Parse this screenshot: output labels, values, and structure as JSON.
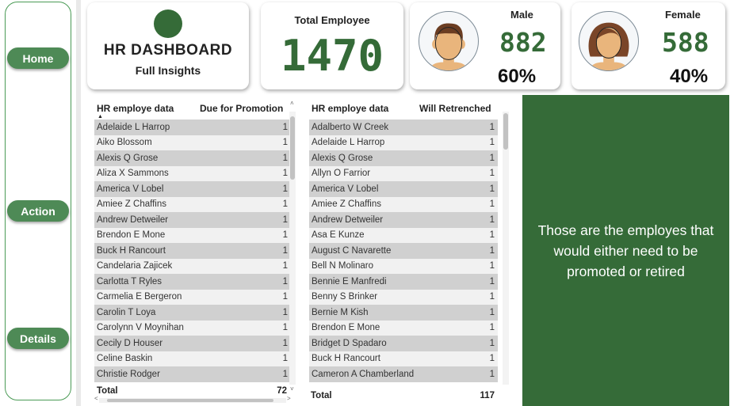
{
  "nav": {
    "home": "Home",
    "action": "Action",
    "details": "Details"
  },
  "header": {
    "title": "HR DASHBOARD",
    "subtitle": "Full Insights",
    "total_label": "Total Employee",
    "total_value": "1470",
    "male_label": "Male",
    "male_value": "882",
    "male_pct": "60%",
    "female_label": "Female",
    "female_value": "588",
    "female_pct": "40%"
  },
  "promotion_table": {
    "col_name": "HR employe data",
    "col_value": "Due for Promotion",
    "rows": [
      {
        "name": "Adelaide L Harrop",
        "value": "1"
      },
      {
        "name": "Aiko Blossom",
        "value": "1"
      },
      {
        "name": "Alexis Q Grose",
        "value": "1"
      },
      {
        "name": "Aliza X Sammons",
        "value": "1"
      },
      {
        "name": "America V Lobel",
        "value": "1"
      },
      {
        "name": "Amiee Z Chaffins",
        "value": "1"
      },
      {
        "name": "Andrew Detweiler",
        "value": "1"
      },
      {
        "name": "Brendon E Mone",
        "value": "1"
      },
      {
        "name": "Buck H Rancourt",
        "value": "1"
      },
      {
        "name": "Candelaria Zajicek",
        "value": "1"
      },
      {
        "name": "Carlotta T Ryles",
        "value": "1"
      },
      {
        "name": "Carmelia E Bergeron",
        "value": "1"
      },
      {
        "name": "Carolin T Loya",
        "value": "1"
      },
      {
        "name": "Carolynn V Moynihan",
        "value": "1"
      },
      {
        "name": "Cecily D Houser",
        "value": "1"
      },
      {
        "name": "Celine Baskin",
        "value": "1"
      },
      {
        "name": "Christie Rodger",
        "value": "1"
      }
    ],
    "total_label": "Total",
    "total_value": "72"
  },
  "retrench_table": {
    "col_name": "HR employe data",
    "col_value": "Will Retrenched",
    "rows": [
      {
        "name": "Adalberto W Creek",
        "value": "1"
      },
      {
        "name": "Adelaide L Harrop",
        "value": "1"
      },
      {
        "name": "Alexis Q Grose",
        "value": "1"
      },
      {
        "name": "Allyn O Farrior",
        "value": "1"
      },
      {
        "name": "America V Lobel",
        "value": "1"
      },
      {
        "name": "Amiee Z Chaffins",
        "value": "1"
      },
      {
        "name": "Andrew Detweiler",
        "value": "1"
      },
      {
        "name": "Asa E Kunze",
        "value": "1"
      },
      {
        "name": "August C Navarette",
        "value": "1"
      },
      {
        "name": "Bell N Molinaro",
        "value": "1"
      },
      {
        "name": "Bennie E Manfredi",
        "value": "1"
      },
      {
        "name": "Benny S Brinker",
        "value": "1"
      },
      {
        "name": "Bernie M Kish",
        "value": "1"
      },
      {
        "name": "Brendon E Mone",
        "value": "1"
      },
      {
        "name": "Bridget D Spadaro",
        "value": "1"
      },
      {
        "name": "Buck H Rancourt",
        "value": "1"
      },
      {
        "name": "Cameron A Chamberland",
        "value": "1"
      }
    ],
    "total_label": "Total",
    "total_value": "117"
  },
  "panel_text": "Those are the employes that would either need to be promoted or retired",
  "colors": {
    "brand_green": "#356b38",
    "nav_button": "#4e8a56"
  },
  "icons": {
    "male": "male-avatar-icon",
    "female": "female-avatar-icon",
    "sort": "sort-up-icon"
  }
}
